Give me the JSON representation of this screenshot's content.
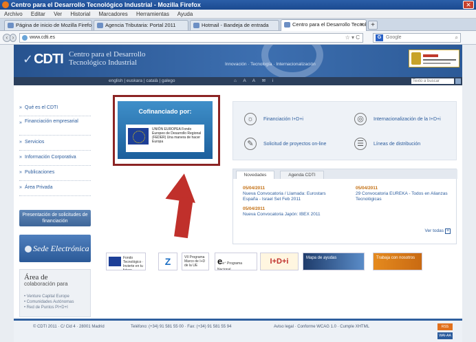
{
  "window": {
    "title": "Centro para el Desarrollo Tecnológico Industrial - Mozilla Firefox",
    "close_glyph": "✕"
  },
  "menubar": [
    "Archivo",
    "Editar",
    "Ver",
    "Historial",
    "Marcadores",
    "Herramientas",
    "Ayuda"
  ],
  "tabs": [
    {
      "label": "Página de inicio de Mozilla Firefox",
      "active": false
    },
    {
      "label": "Agencia Tributaria: Portal 2011",
      "active": false
    },
    {
      "label": "Hotmail - Bandeja de entrada",
      "active": false
    },
    {
      "label": "Centro para el Desarrollo Tecnológico Ind...",
      "active": true
    }
  ],
  "newtab_glyph": "+",
  "nav": {
    "back": "‹",
    "forward": "›",
    "url": "www.cdti.es",
    "star": "☆ ▾ C",
    "search_engine": "G",
    "search_placeholder": "Google",
    "search_glyph": "⌕"
  },
  "site": {
    "logo": "CDTI",
    "logo_mark": "✓",
    "tagline": "Centro para el Desarrollo Tecnológico Industrial",
    "banner_strip": "Innovación · Tecnología · Internacionalización",
    "subnav_langs": "english | euskara | català | galego",
    "subnav_tools": "⌂ A A ✉ i",
    "search_placeholder": "Texto a buscar"
  },
  "sidebar": {
    "items": [
      "Qué es el CDTI",
      "Financiación empresarial",
      "Servicios",
      "Información Corporativa",
      "Publicaciones",
      "Área Privada"
    ],
    "btn_solicitudes": "Presentación de solicitudes de financiación",
    "btn_sede": "Sede Electrónica",
    "area_title": "Área de",
    "area_subtitle": "colaboración para",
    "area_links": "• Venture Capital Europe\n• Comunidades Autónomas\n• Red de Puntos PI+D+I"
  },
  "promo": {
    "title": "Cofinanciado por:",
    "text": "UNIÓN EUROPEA Fondo Europeo de Desarrollo Regional (FEDER) Una manera de hacer Europa"
  },
  "panel": {
    "items": [
      {
        "icon": "lightbulb-icon",
        "glyph": "☼",
        "label": "Financiación I+D+i"
      },
      {
        "icon": "globe-icon",
        "glyph": "◎",
        "label": "Internacionalización de la I+D+i"
      },
      {
        "icon": "pen-icon",
        "glyph": "✎",
        "label": "Solicitud de proyectos on-line"
      },
      {
        "icon": "list-icon",
        "glyph": "☰",
        "label": "Líneas de distribución"
      }
    ]
  },
  "news": {
    "tabs": [
      "Novedades",
      "Agenda CDTI"
    ],
    "col1": [
      {
        "date": "05/04/2011",
        "text": "Nueva Convocatoria / Llamada: Eurostars España - Israel Set Feb 2011"
      },
      {
        "date": "05/04/2011",
        "text": "Nueva Convocatoria Japón: IBEX 2011"
      }
    ],
    "col2": [
      {
        "date": "05/04/2011",
        "text": "29 Convocatoria EUREKA - Todos en Alianzas Tecnológicas"
      }
    ],
    "ver_todas": "Ver todas",
    "ver_plus": "+"
  },
  "logos": [
    {
      "name": "eu-feder-logo",
      "text": "Fondo Tecnológico · Invierte en tu futuro"
    },
    {
      "name": "ministerio-logo",
      "text": "Z"
    },
    {
      "name": "programa-marco-logo",
      "text": "VII Programa Marco de I+D de la UE"
    },
    {
      "name": "e-plus-logo",
      "text": "e⁺ Programa Nacional"
    },
    {
      "name": "idi-logo",
      "text": "I+D+i"
    },
    {
      "name": "mapa-ayudas-logo",
      "text": "Mapa de ayudas"
    },
    {
      "name": "trabaja-logo",
      "text": "Trabaja con nosotros"
    }
  ],
  "footer": {
    "col1": "© CDTI 2011 · C/ Cid 4 · 28001 Madrid",
    "col2": "Teléfono: (+34) 91 581 55 00 · Fax: (+34) 91 581 55 94",
    "col3": "Aviso legal · Conforme WCAG 1.0 · Cumple XHTML",
    "badge1": "RSS",
    "badge2": "WAI-AA"
  },
  "colors": {
    "accent_red": "#c0302b",
    "brand_blue": "#2f5f9e",
    "news_date": "#c36f12"
  }
}
